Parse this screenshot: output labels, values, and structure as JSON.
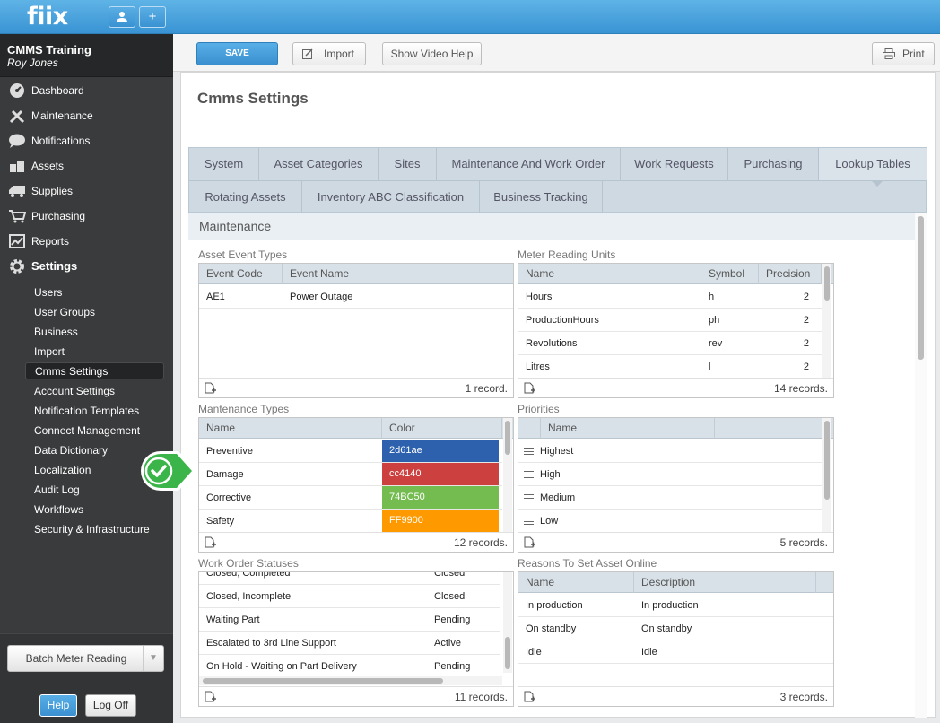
{
  "app": {
    "logo": "fiix",
    "user_icon": "user-icon",
    "add_icon": "+"
  },
  "sidebar": {
    "org": "CMMS Training",
    "user": "Roy Jones",
    "nav": [
      {
        "label": "Dashboard",
        "icon": "dashboard-icon"
      },
      {
        "label": "Maintenance",
        "icon": "tools-icon"
      },
      {
        "label": "Notifications",
        "icon": "chat-bubble-icon"
      },
      {
        "label": "Assets",
        "icon": "boxes-icon"
      },
      {
        "label": "Supplies",
        "icon": "truck-icon"
      },
      {
        "label": "Purchasing",
        "icon": "cart-icon"
      },
      {
        "label": "Reports",
        "icon": "chart-icon"
      },
      {
        "label": "Settings",
        "icon": "gear-icon"
      }
    ],
    "settings_items": [
      "Users",
      "User Groups",
      "Business",
      "Import",
      "Cmms Settings",
      "Account Settings",
      "Notification Templates",
      "Connect Management",
      "Data Dictionary",
      "Localization",
      "Audit Log",
      "Workflows",
      "Security & Infrastructure"
    ],
    "active_item": "Cmms Settings",
    "batch_meter": "Batch Meter Reading",
    "help": "Help",
    "logoff": "Log Off"
  },
  "toolbar": {
    "save": "SAVE",
    "import": "Import",
    "video_help": "Show Video Help",
    "print": "Print"
  },
  "page": {
    "title": "Cmms Settings",
    "section": "Maintenance"
  },
  "tabs": {
    "row1": [
      "System",
      "Asset Categories",
      "Sites",
      "Maintenance And Work Order",
      "Work Requests",
      "Purchasing",
      "Lookup Tables"
    ],
    "row2": [
      "Rotating Assets",
      "Inventory ABC Classification",
      "Business Tracking"
    ],
    "selected": "Lookup Tables"
  },
  "grids": {
    "asset_event_types": {
      "title": "Asset Event Types",
      "columns": [
        "Event Code",
        "Event Name"
      ],
      "rows": [
        [
          "AE1",
          "Power Outage"
        ]
      ],
      "count": "1 record."
    },
    "meter_reading_units": {
      "title": "Meter Reading Units",
      "columns": [
        "Name",
        "Symbol",
        "Precision"
      ],
      "rows": [
        [
          "Hours",
          "h",
          "2"
        ],
        [
          "ProductionHours",
          "ph",
          "2"
        ],
        [
          "Revolutions",
          "rev",
          "2"
        ],
        [
          "Litres",
          "l",
          "2"
        ]
      ],
      "count": "14 records."
    },
    "maintenance_types": {
      "title": "Mantenance Types",
      "columns": [
        "Name",
        "Color"
      ],
      "rows": [
        {
          "name": "Preventive",
          "color": "2d61ae",
          "hex": "#2d61ae"
        },
        {
          "name": "Damage",
          "color": "cc4140",
          "hex": "#cc4140"
        },
        {
          "name": "Corrective",
          "color": "74BC50",
          "hex": "#74bc50"
        },
        {
          "name": "Safety",
          "color": "FF9900",
          "hex": "#ff9900"
        }
      ],
      "count": "12 records."
    },
    "priorities": {
      "title": "Priorities",
      "columns": [
        "Name"
      ],
      "rows": [
        "Highest",
        "High",
        "Medium",
        "Low"
      ],
      "count": "5 records."
    },
    "work_order_statuses": {
      "title": "Work Order Statuses",
      "rows": [
        [
          "Closed, Completed",
          "Closed"
        ],
        [
          "Closed, Incomplete",
          "Closed"
        ],
        [
          "Waiting Part",
          "Pending"
        ],
        [
          "Escalated to 3rd Line Support",
          "Active"
        ],
        [
          "On Hold - Waiting on Part Delivery",
          "Pending"
        ]
      ],
      "count": "11 records."
    },
    "reasons_online": {
      "title": "Reasons To Set Asset Online",
      "columns": [
        "Name",
        "Description"
      ],
      "rows": [
        [
          "In production",
          "In production"
        ],
        [
          "On standby",
          "On standby"
        ],
        [
          "Idle",
          "Idle"
        ]
      ],
      "count": "3 records."
    }
  },
  "colors": {
    "accent": "#3b90d0",
    "success": "#3bb54a"
  }
}
